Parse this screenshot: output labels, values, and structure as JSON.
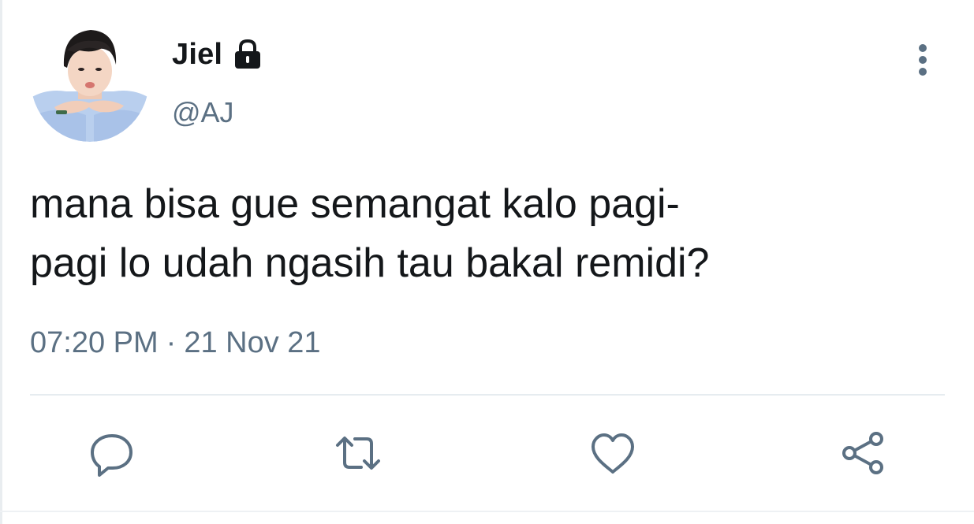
{
  "user": {
    "display_name": "Jiel",
    "handle": "@AJ",
    "protected_icon": "lock-icon",
    "avatar": "profile-photo"
  },
  "tweet": {
    "text": "mana bisa gue semangat kalo pagi-\npagi lo udah ngasih tau bakal remidi?",
    "time": "07:20 PM",
    "separator": "·",
    "date": "21 Nov 21"
  },
  "actions": {
    "reply_icon": "reply-icon",
    "retweet_icon": "retweet-icon",
    "like_icon": "heart-icon",
    "share_icon": "share-icon"
  },
  "menu_icon": "more-vertical-icon",
  "colors": {
    "text": "#14171a",
    "secondary": "#5b7083",
    "divider": "#e6ecf0"
  }
}
